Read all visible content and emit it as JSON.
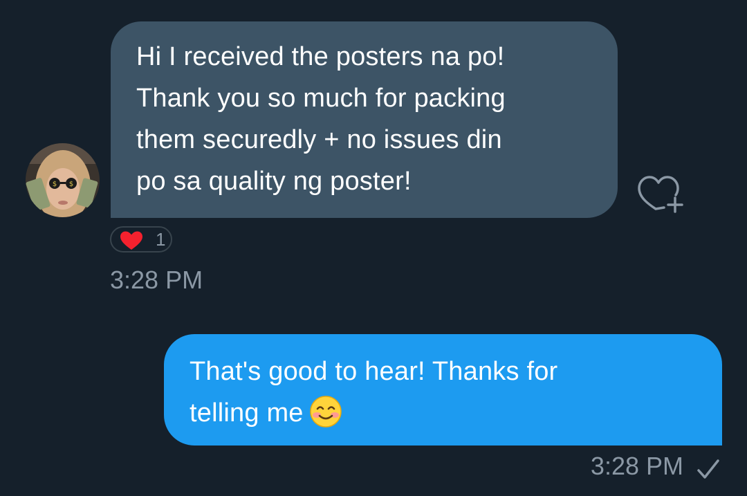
{
  "conversation": {
    "incoming": {
      "lines": [
        "Hi I received the posters na po!",
        "Thank you so much for packing",
        "them securedly + no issues din",
        "po sa quality ng poster!"
      ],
      "reaction": {
        "icon": "heart-icon",
        "count": "1",
        "color": "#f91880"
      },
      "time": "3:28 PM"
    },
    "outgoing": {
      "lines": [
        "That's good to hear! Thanks for",
        "telling me"
      ],
      "emoji": "smiling-face-with-blush-emoji",
      "time": "3:28 PM",
      "status_icon": "check-icon"
    }
  },
  "colors": {
    "background": "#15202b",
    "incoming_bubble": "#3d5466",
    "outgoing_bubble": "#1d9bf0",
    "muted_text": "#8b98a5"
  }
}
